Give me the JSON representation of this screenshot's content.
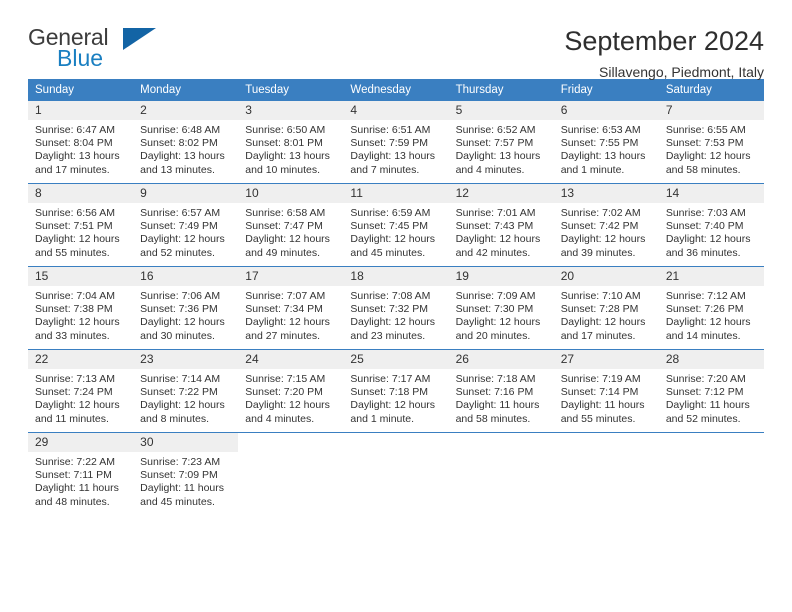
{
  "brand": {
    "name_top": "General",
    "name_bottom": "Blue",
    "flag_icon": "blue-triangle-flag-icon",
    "color_top": "#3c3c3c",
    "color_bottom": "#1a7fc1"
  },
  "header": {
    "title": "September 2024",
    "subtitle": "Sillavengo, Piedmont, Italy"
  },
  "theme": {
    "header_blue": "#3a7fc1",
    "daynum_band": "#efefef",
    "text": "#333333"
  },
  "weekday_headers": [
    "Sunday",
    "Monday",
    "Tuesday",
    "Wednesday",
    "Thursday",
    "Friday",
    "Saturday"
  ],
  "weeks": [
    [
      {
        "day": "1",
        "sunrise": "Sunrise: 6:47 AM",
        "sunset": "Sunset: 8:04 PM",
        "daylight": "Daylight: 13 hours and 17 minutes."
      },
      {
        "day": "2",
        "sunrise": "Sunrise: 6:48 AM",
        "sunset": "Sunset: 8:02 PM",
        "daylight": "Daylight: 13 hours and 13 minutes."
      },
      {
        "day": "3",
        "sunrise": "Sunrise: 6:50 AM",
        "sunset": "Sunset: 8:01 PM",
        "daylight": "Daylight: 13 hours and 10 minutes."
      },
      {
        "day": "4",
        "sunrise": "Sunrise: 6:51 AM",
        "sunset": "Sunset: 7:59 PM",
        "daylight": "Daylight: 13 hours and 7 minutes."
      },
      {
        "day": "5",
        "sunrise": "Sunrise: 6:52 AM",
        "sunset": "Sunset: 7:57 PM",
        "daylight": "Daylight: 13 hours and 4 minutes."
      },
      {
        "day": "6",
        "sunrise": "Sunrise: 6:53 AM",
        "sunset": "Sunset: 7:55 PM",
        "daylight": "Daylight: 13 hours and 1 minute."
      },
      {
        "day": "7",
        "sunrise": "Sunrise: 6:55 AM",
        "sunset": "Sunset: 7:53 PM",
        "daylight": "Daylight: 12 hours and 58 minutes."
      }
    ],
    [
      {
        "day": "8",
        "sunrise": "Sunrise: 6:56 AM",
        "sunset": "Sunset: 7:51 PM",
        "daylight": "Daylight: 12 hours and 55 minutes."
      },
      {
        "day": "9",
        "sunrise": "Sunrise: 6:57 AM",
        "sunset": "Sunset: 7:49 PM",
        "daylight": "Daylight: 12 hours and 52 minutes."
      },
      {
        "day": "10",
        "sunrise": "Sunrise: 6:58 AM",
        "sunset": "Sunset: 7:47 PM",
        "daylight": "Daylight: 12 hours and 49 minutes."
      },
      {
        "day": "11",
        "sunrise": "Sunrise: 6:59 AM",
        "sunset": "Sunset: 7:45 PM",
        "daylight": "Daylight: 12 hours and 45 minutes."
      },
      {
        "day": "12",
        "sunrise": "Sunrise: 7:01 AM",
        "sunset": "Sunset: 7:43 PM",
        "daylight": "Daylight: 12 hours and 42 minutes."
      },
      {
        "day": "13",
        "sunrise": "Sunrise: 7:02 AM",
        "sunset": "Sunset: 7:42 PM",
        "daylight": "Daylight: 12 hours and 39 minutes."
      },
      {
        "day": "14",
        "sunrise": "Sunrise: 7:03 AM",
        "sunset": "Sunset: 7:40 PM",
        "daylight": "Daylight: 12 hours and 36 minutes."
      }
    ],
    [
      {
        "day": "15",
        "sunrise": "Sunrise: 7:04 AM",
        "sunset": "Sunset: 7:38 PM",
        "daylight": "Daylight: 12 hours and 33 minutes."
      },
      {
        "day": "16",
        "sunrise": "Sunrise: 7:06 AM",
        "sunset": "Sunset: 7:36 PM",
        "daylight": "Daylight: 12 hours and 30 minutes."
      },
      {
        "day": "17",
        "sunrise": "Sunrise: 7:07 AM",
        "sunset": "Sunset: 7:34 PM",
        "daylight": "Daylight: 12 hours and 27 minutes."
      },
      {
        "day": "18",
        "sunrise": "Sunrise: 7:08 AM",
        "sunset": "Sunset: 7:32 PM",
        "daylight": "Daylight: 12 hours and 23 minutes."
      },
      {
        "day": "19",
        "sunrise": "Sunrise: 7:09 AM",
        "sunset": "Sunset: 7:30 PM",
        "daylight": "Daylight: 12 hours and 20 minutes."
      },
      {
        "day": "20",
        "sunrise": "Sunrise: 7:10 AM",
        "sunset": "Sunset: 7:28 PM",
        "daylight": "Daylight: 12 hours and 17 minutes."
      },
      {
        "day": "21",
        "sunrise": "Sunrise: 7:12 AM",
        "sunset": "Sunset: 7:26 PM",
        "daylight": "Daylight: 12 hours and 14 minutes."
      }
    ],
    [
      {
        "day": "22",
        "sunrise": "Sunrise: 7:13 AM",
        "sunset": "Sunset: 7:24 PM",
        "daylight": "Daylight: 12 hours and 11 minutes."
      },
      {
        "day": "23",
        "sunrise": "Sunrise: 7:14 AM",
        "sunset": "Sunset: 7:22 PM",
        "daylight": "Daylight: 12 hours and 8 minutes."
      },
      {
        "day": "24",
        "sunrise": "Sunrise: 7:15 AM",
        "sunset": "Sunset: 7:20 PM",
        "daylight": "Daylight: 12 hours and 4 minutes."
      },
      {
        "day": "25",
        "sunrise": "Sunrise: 7:17 AM",
        "sunset": "Sunset: 7:18 PM",
        "daylight": "Daylight: 12 hours and 1 minute."
      },
      {
        "day": "26",
        "sunrise": "Sunrise: 7:18 AM",
        "sunset": "Sunset: 7:16 PM",
        "daylight": "Daylight: 11 hours and 58 minutes."
      },
      {
        "day": "27",
        "sunrise": "Sunrise: 7:19 AM",
        "sunset": "Sunset: 7:14 PM",
        "daylight": "Daylight: 11 hours and 55 minutes."
      },
      {
        "day": "28",
        "sunrise": "Sunrise: 7:20 AM",
        "sunset": "Sunset: 7:12 PM",
        "daylight": "Daylight: 11 hours and 52 minutes."
      }
    ],
    [
      {
        "day": "29",
        "sunrise": "Sunrise: 7:22 AM",
        "sunset": "Sunset: 7:11 PM",
        "daylight": "Daylight: 11 hours and 48 minutes."
      },
      {
        "day": "30",
        "sunrise": "Sunrise: 7:23 AM",
        "sunset": "Sunset: 7:09 PM",
        "daylight": "Daylight: 11 hours and 45 minutes."
      },
      {
        "day": "",
        "sunrise": "",
        "sunset": "",
        "daylight": ""
      },
      {
        "day": "",
        "sunrise": "",
        "sunset": "",
        "daylight": ""
      },
      {
        "day": "",
        "sunrise": "",
        "sunset": "",
        "daylight": ""
      },
      {
        "day": "",
        "sunrise": "",
        "sunset": "",
        "daylight": ""
      },
      {
        "day": "",
        "sunrise": "",
        "sunset": "",
        "daylight": ""
      }
    ]
  ]
}
